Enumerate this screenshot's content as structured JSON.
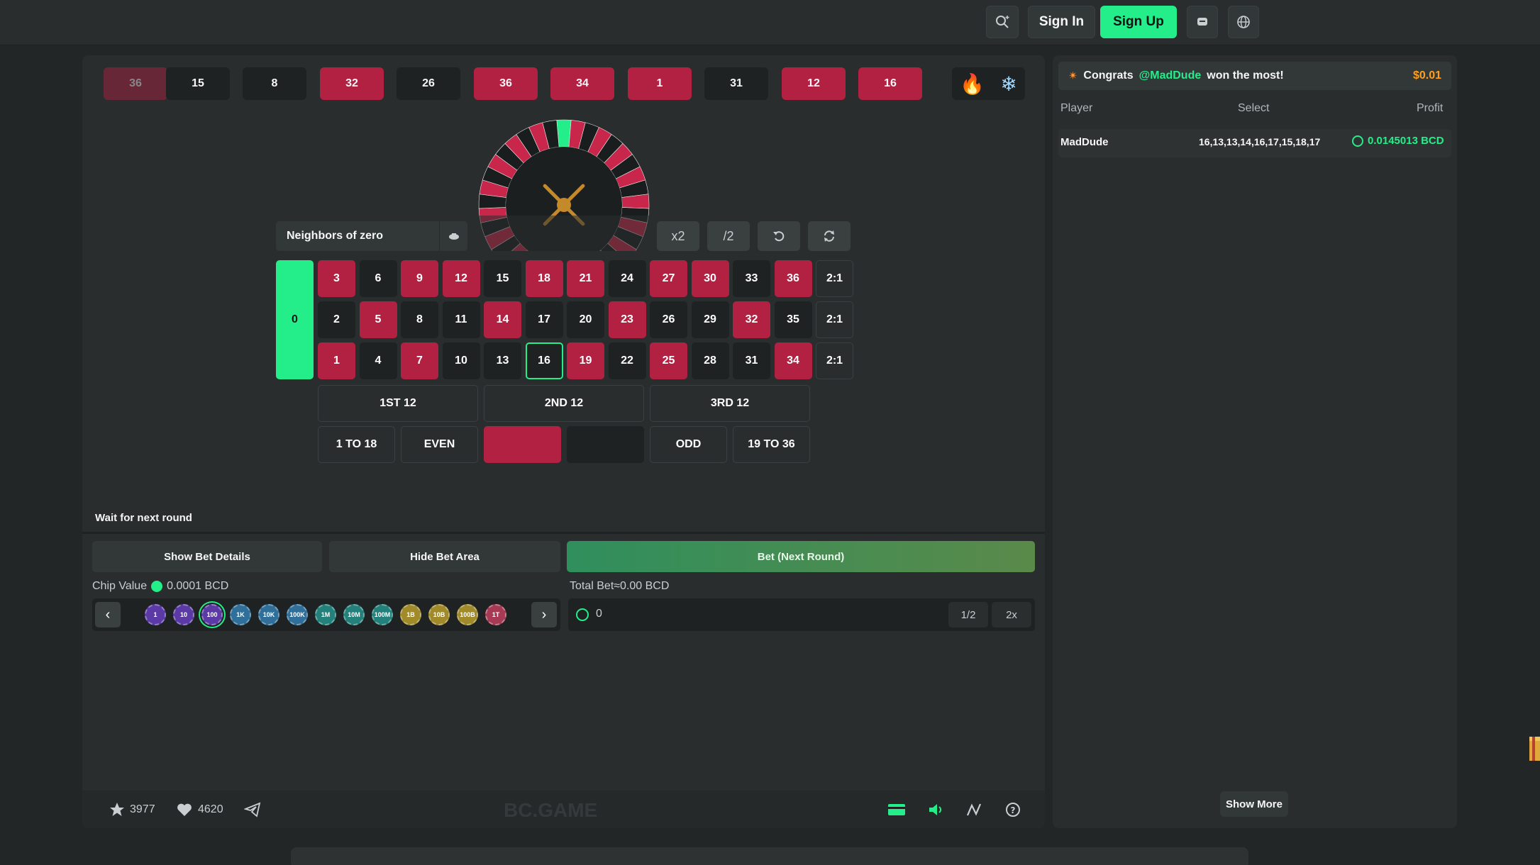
{
  "header": {
    "sign_in": "Sign In",
    "sign_up": "Sign Up"
  },
  "history": [
    {
      "value": "36",
      "color": "red"
    },
    {
      "value": "15",
      "color": "black"
    },
    {
      "value": "8",
      "color": "black"
    },
    {
      "value": "32",
      "color": "red"
    },
    {
      "value": "26",
      "color": "black"
    },
    {
      "value": "36",
      "color": "red"
    },
    {
      "value": "34",
      "color": "red"
    },
    {
      "value": "1",
      "color": "red"
    },
    {
      "value": "31",
      "color": "black"
    },
    {
      "value": "12",
      "color": "red"
    },
    {
      "value": "16",
      "color": "red"
    }
  ],
  "bet_preset": "Neighbors of zero",
  "controls": {
    "double": "x2",
    "half": "/2"
  },
  "board": {
    "zero": "0",
    "rows": [
      [
        {
          "n": "3",
          "c": "red"
        },
        {
          "n": "6",
          "c": "black"
        },
        {
          "n": "9",
          "c": "red"
        },
        {
          "n": "12",
          "c": "red"
        },
        {
          "n": "15",
          "c": "black"
        },
        {
          "n": "18",
          "c": "red"
        },
        {
          "n": "21",
          "c": "red"
        },
        {
          "n": "24",
          "c": "black"
        },
        {
          "n": "27",
          "c": "red"
        },
        {
          "n": "30",
          "c": "red"
        },
        {
          "n": "33",
          "c": "black"
        },
        {
          "n": "36",
          "c": "red"
        }
      ],
      [
        {
          "n": "2",
          "c": "black"
        },
        {
          "n": "5",
          "c": "red"
        },
        {
          "n": "8",
          "c": "black"
        },
        {
          "n": "11",
          "c": "black"
        },
        {
          "n": "14",
          "c": "red"
        },
        {
          "n": "17",
          "c": "black"
        },
        {
          "n": "20",
          "c": "black"
        },
        {
          "n": "23",
          "c": "red"
        },
        {
          "n": "26",
          "c": "black"
        },
        {
          "n": "29",
          "c": "black"
        },
        {
          "n": "32",
          "c": "red"
        },
        {
          "n": "35",
          "c": "black"
        }
      ],
      [
        {
          "n": "1",
          "c": "red"
        },
        {
          "n": "4",
          "c": "black"
        },
        {
          "n": "7",
          "c": "red"
        },
        {
          "n": "10",
          "c": "black"
        },
        {
          "n": "13",
          "c": "black"
        },
        {
          "n": "16",
          "c": "highlight"
        },
        {
          "n": "19",
          "c": "red"
        },
        {
          "n": "22",
          "c": "black"
        },
        {
          "n": "25",
          "c": "red"
        },
        {
          "n": "28",
          "c": "black"
        },
        {
          "n": "31",
          "c": "black"
        },
        {
          "n": "34",
          "c": "red"
        }
      ]
    ],
    "column_bet": "2:1",
    "dozens": [
      "1ST 12",
      "2ND 12",
      "3RD 12"
    ],
    "outside": {
      "low": "1 TO 18",
      "even": "EVEN",
      "odd": "ODD",
      "high": "19 TO 36"
    }
  },
  "status": "Wait for next round",
  "panel": {
    "show_details": "Show Bet Details",
    "hide_area": "Hide Bet Area",
    "bet_button": "Bet (Next Round)",
    "chip_value_label": "Chip Value",
    "chip_value": "0.0001 BCD",
    "total_bet": "Total Bet≈0.00 BCD",
    "amount": "0",
    "half": "1/2",
    "double": "2x"
  },
  "chips": [
    {
      "label": "1",
      "color": "#5c3aa6"
    },
    {
      "label": "10",
      "color": "#5c3aa6"
    },
    {
      "label": "100",
      "color": "#5c3aa6"
    },
    {
      "label": "1K",
      "color": "#2f6f9a"
    },
    {
      "label": "10K",
      "color": "#2f6f9a"
    },
    {
      "label": "100K",
      "color": "#2f6f9a"
    },
    {
      "label": "1M",
      "color": "#23807a"
    },
    {
      "label": "10M",
      "color": "#23807a"
    },
    {
      "label": "100M",
      "color": "#23807a"
    },
    {
      "label": "1B",
      "color": "#a08a2a"
    },
    {
      "label": "10B",
      "color": "#a08a2a"
    },
    {
      "label": "100B",
      "color": "#a08a2a"
    },
    {
      "label": "1T",
      "color": "#a63a55"
    }
  ],
  "footer": {
    "stars": "3977",
    "likes": "4620",
    "watermark": "BC.GAME"
  },
  "sidebar": {
    "congrats_prefix": "Congrats",
    "winner_handle": "@MadDude",
    "congrats_suffix": "won the most!",
    "top_amount": "$0.01",
    "headers": {
      "player": "Player",
      "select": "Select",
      "profit": "Profit"
    },
    "rows": [
      {
        "player": "MadDude",
        "select": "16,13,13,14,16,17,15,18,17",
        "profit": "0.0145013 BCD"
      }
    ],
    "show_more": "Show More"
  }
}
